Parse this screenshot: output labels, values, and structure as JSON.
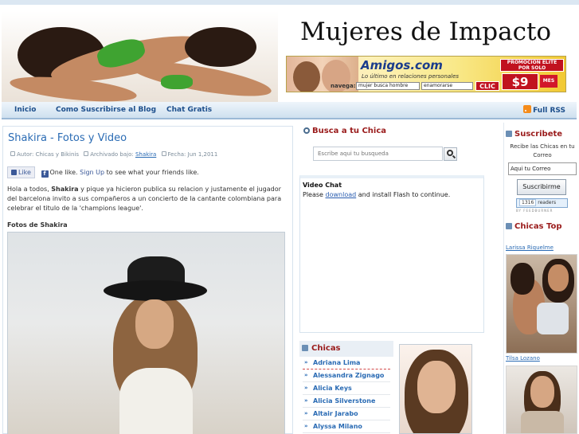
{
  "header": {
    "site_title": "Mujeres de Impacto",
    "photo_icon": "header-women-photo"
  },
  "banner": {
    "brand": "Amigos.com",
    "tagline": "Lo último en relaciones personales",
    "promo": "PROMOCION ELITE POR SOLO",
    "price": "$9",
    "price_unit": "MES",
    "nav_label": "navega:",
    "select_1": "mujer busca hombre",
    "select_2": "enamorarse",
    "cta": "CLIC"
  },
  "nav": {
    "items": [
      {
        "label": "Inicio"
      },
      {
        "label": "Como Suscribirse al Blog"
      },
      {
        "label": "Chat Gratis"
      }
    ],
    "rss_label": "Full RSS",
    "rss_icon": "rss-icon"
  },
  "post": {
    "title": "Shakira - Fotos y Video",
    "meta_author_label": "Autor:",
    "meta_author": "Chicas y Bikinis",
    "meta_filed_label": "Archivado bajo:",
    "meta_filed": "Shakira",
    "meta_date_label": "Fecha:",
    "meta_date": "Jun 1,2011",
    "like_button": "Like",
    "like_text_1": "One like.",
    "like_signup": "Sign Up",
    "like_text_2": "to see what your friends like.",
    "body_1": "Hola a todos,",
    "body_bold": "Shakira",
    "body_2": "y pique ya hicieron publica su relacion y justamente el jugador del barcelona invito a sus compañeros a un concierto de la cantante colombiana para celebrar el titulo de la 'champions league'.",
    "subtitle": "Fotos de Shakira"
  },
  "search": {
    "heading": "Busca a tu Chica",
    "placeholder": "Escribe aqui tu busqueda"
  },
  "video": {
    "title": "Video Chat",
    "text_1": "Please",
    "link": "download",
    "text_2": "and install Flash to continue."
  },
  "chicas": {
    "heading": "Chicas",
    "items": [
      "Adriana Lima",
      "Alessandra Zignago",
      "Alicia Keys",
      "Alicia Silverstone",
      "Altair Jarabo",
      "Alyssa Milano"
    ]
  },
  "subscribe": {
    "heading": "Suscribete",
    "text": "Recibe las Chicas en tu Correo",
    "email_value": "Aqui tu Correo",
    "button": "Suscribirme",
    "readers_count": "1316",
    "readers_label": "readers",
    "by_label": "BY FEEDBURNER"
  },
  "top": {
    "heading": "Chicas Top",
    "items": [
      {
        "name": "Larissa Riquelme"
      },
      {
        "name": "Tilsa Lozano"
      }
    ]
  },
  "colors": {
    "link_blue": "#2a6bb4",
    "heading_red": "#9a1b1b",
    "nav_blue": "#1d4f8c"
  }
}
